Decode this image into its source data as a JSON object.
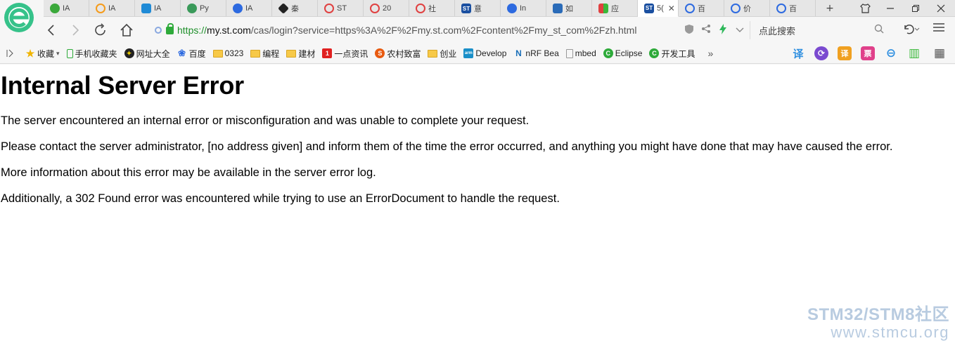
{
  "browser": {
    "tabs": [
      {
        "label": "IA",
        "icon": "green-circle-icon",
        "color": "#3aa83a"
      },
      {
        "label": "IA",
        "icon": "orange-ring-icon",
        "color": "#f59b1a"
      },
      {
        "label": "IA",
        "icon": "blue-leaf-icon",
        "color": "#1f8ad6"
      },
      {
        "label": "Py",
        "icon": "globe-icon",
        "color": "#3a9a5a"
      },
      {
        "label": "IA",
        "icon": "paw-icon",
        "color": "#2d6ae0"
      },
      {
        "label": "秦",
        "icon": "diamond-icon",
        "color": "#222222"
      },
      {
        "label": "ST",
        "icon": "knot-icon",
        "color": "#e04040"
      },
      {
        "label": "20",
        "icon": "knot-icon",
        "color": "#e04040"
      },
      {
        "label": "社",
        "icon": "knot-icon",
        "color": "#e04040"
      },
      {
        "label": "意",
        "icon": "st-logo-icon",
        "color": "#1a4fa0"
      },
      {
        "label": "In",
        "icon": "paw-icon",
        "color": "#2d6ae0"
      },
      {
        "label": "如",
        "icon": "blue-square-icon",
        "color": "#2a6bb8"
      },
      {
        "label": "应",
        "icon": "grid-icon",
        "color": "#e04040"
      },
      {
        "label": "5(",
        "icon": "st-logo-icon",
        "color": "#1a4fa0",
        "active": true
      },
      {
        "label": "百",
        "icon": "cloud-icon",
        "color": "#2d6ae0"
      },
      {
        "label": "价",
        "icon": "cloud-icon",
        "color": "#2d6ae0"
      },
      {
        "label": "百",
        "icon": "cloud-icon",
        "color": "#2d6ae0"
      }
    ],
    "tab_close_glyph": "✕",
    "new_tab_glyph": "+",
    "address": {
      "scheme": "https://",
      "host": "my.st.com",
      "path": "/cas/login?service=https%3A%2F%2Fmy.st.com%2Fcontent%2Fmy_st_com%2Fzh.html"
    },
    "search_placeholder": "点此搜索",
    "bookmarks": [
      {
        "label": "收藏",
        "icon": "star-icon"
      },
      {
        "label": "手机收藏夹",
        "icon": "phone-icon"
      },
      {
        "label": "网址大全",
        "icon": "compass-icon"
      },
      {
        "label": "百度",
        "icon": "paw-icon"
      },
      {
        "label": "0323",
        "icon": "folder-icon"
      },
      {
        "label": "编程",
        "icon": "folder-icon"
      },
      {
        "label": "建材",
        "icon": "folder-icon"
      },
      {
        "label": "一点资讯",
        "icon": "yidian-icon"
      },
      {
        "label": "农村致富",
        "icon": "sohu-icon"
      },
      {
        "label": "创业",
        "icon": "folder-icon"
      },
      {
        "label": "Develop",
        "icon": "arm-icon"
      },
      {
        "label": "nRF Bea",
        "icon": "nordic-icon"
      },
      {
        "label": "mbed",
        "icon": "page-icon"
      },
      {
        "label": "Eclipse",
        "icon": "eclipse-icon"
      },
      {
        "label": "开发工具",
        "icon": "eclipse-icon"
      }
    ],
    "more_glyph": "»",
    "extensions": [
      {
        "label": "译",
        "icon": "translate-icon",
        "color": "#2f8fe0"
      },
      {
        "label": "⟳",
        "icon": "sync-icon",
        "color": "#7a4ad0"
      },
      {
        "label": "译",
        "icon": "translate-alt-icon",
        "color": "#f0a020"
      },
      {
        "label": "票",
        "icon": "ticket-icon",
        "color": "#e0408a"
      },
      {
        "label": "⊖",
        "icon": "minus-circle-icon",
        "color": "#2f8fe0"
      },
      {
        "label": "▥",
        "icon": "book-icon",
        "color": "#3ab83a"
      },
      {
        "label": "▦",
        "icon": "apps-icon",
        "color": "#555555"
      }
    ]
  },
  "page": {
    "title": "Internal Server Error",
    "paragraphs": [
      "The server encountered an internal error or misconfiguration and was unable to complete your request.",
      "Please contact the server administrator, [no address given] and inform them of the time the error occurred, and anything you might have done that may have caused the error.",
      "More information about this error may be available in the server error log.",
      "Additionally, a 302 Found error was encountered while trying to use an ErrorDocument to handle the request."
    ]
  },
  "watermark": {
    "line1": "STM32/STM8社区",
    "line2": "www.stmcu.org",
    "color": "#b8cbe0"
  }
}
